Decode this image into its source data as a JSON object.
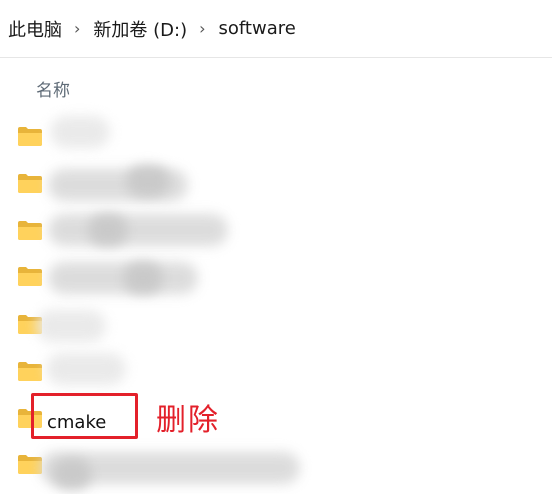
{
  "breadcrumb": {
    "items": [
      "此电脑",
      "新加卷 (D:)",
      "software"
    ],
    "separator": "›"
  },
  "columns": {
    "name": "名称"
  },
  "files": {
    "visible_name": "cmake"
  },
  "annotation": {
    "label": "删除",
    "color": "#e3202a"
  },
  "icons": {
    "folder": "folder-icon",
    "separator": "chevron-right-icon"
  }
}
